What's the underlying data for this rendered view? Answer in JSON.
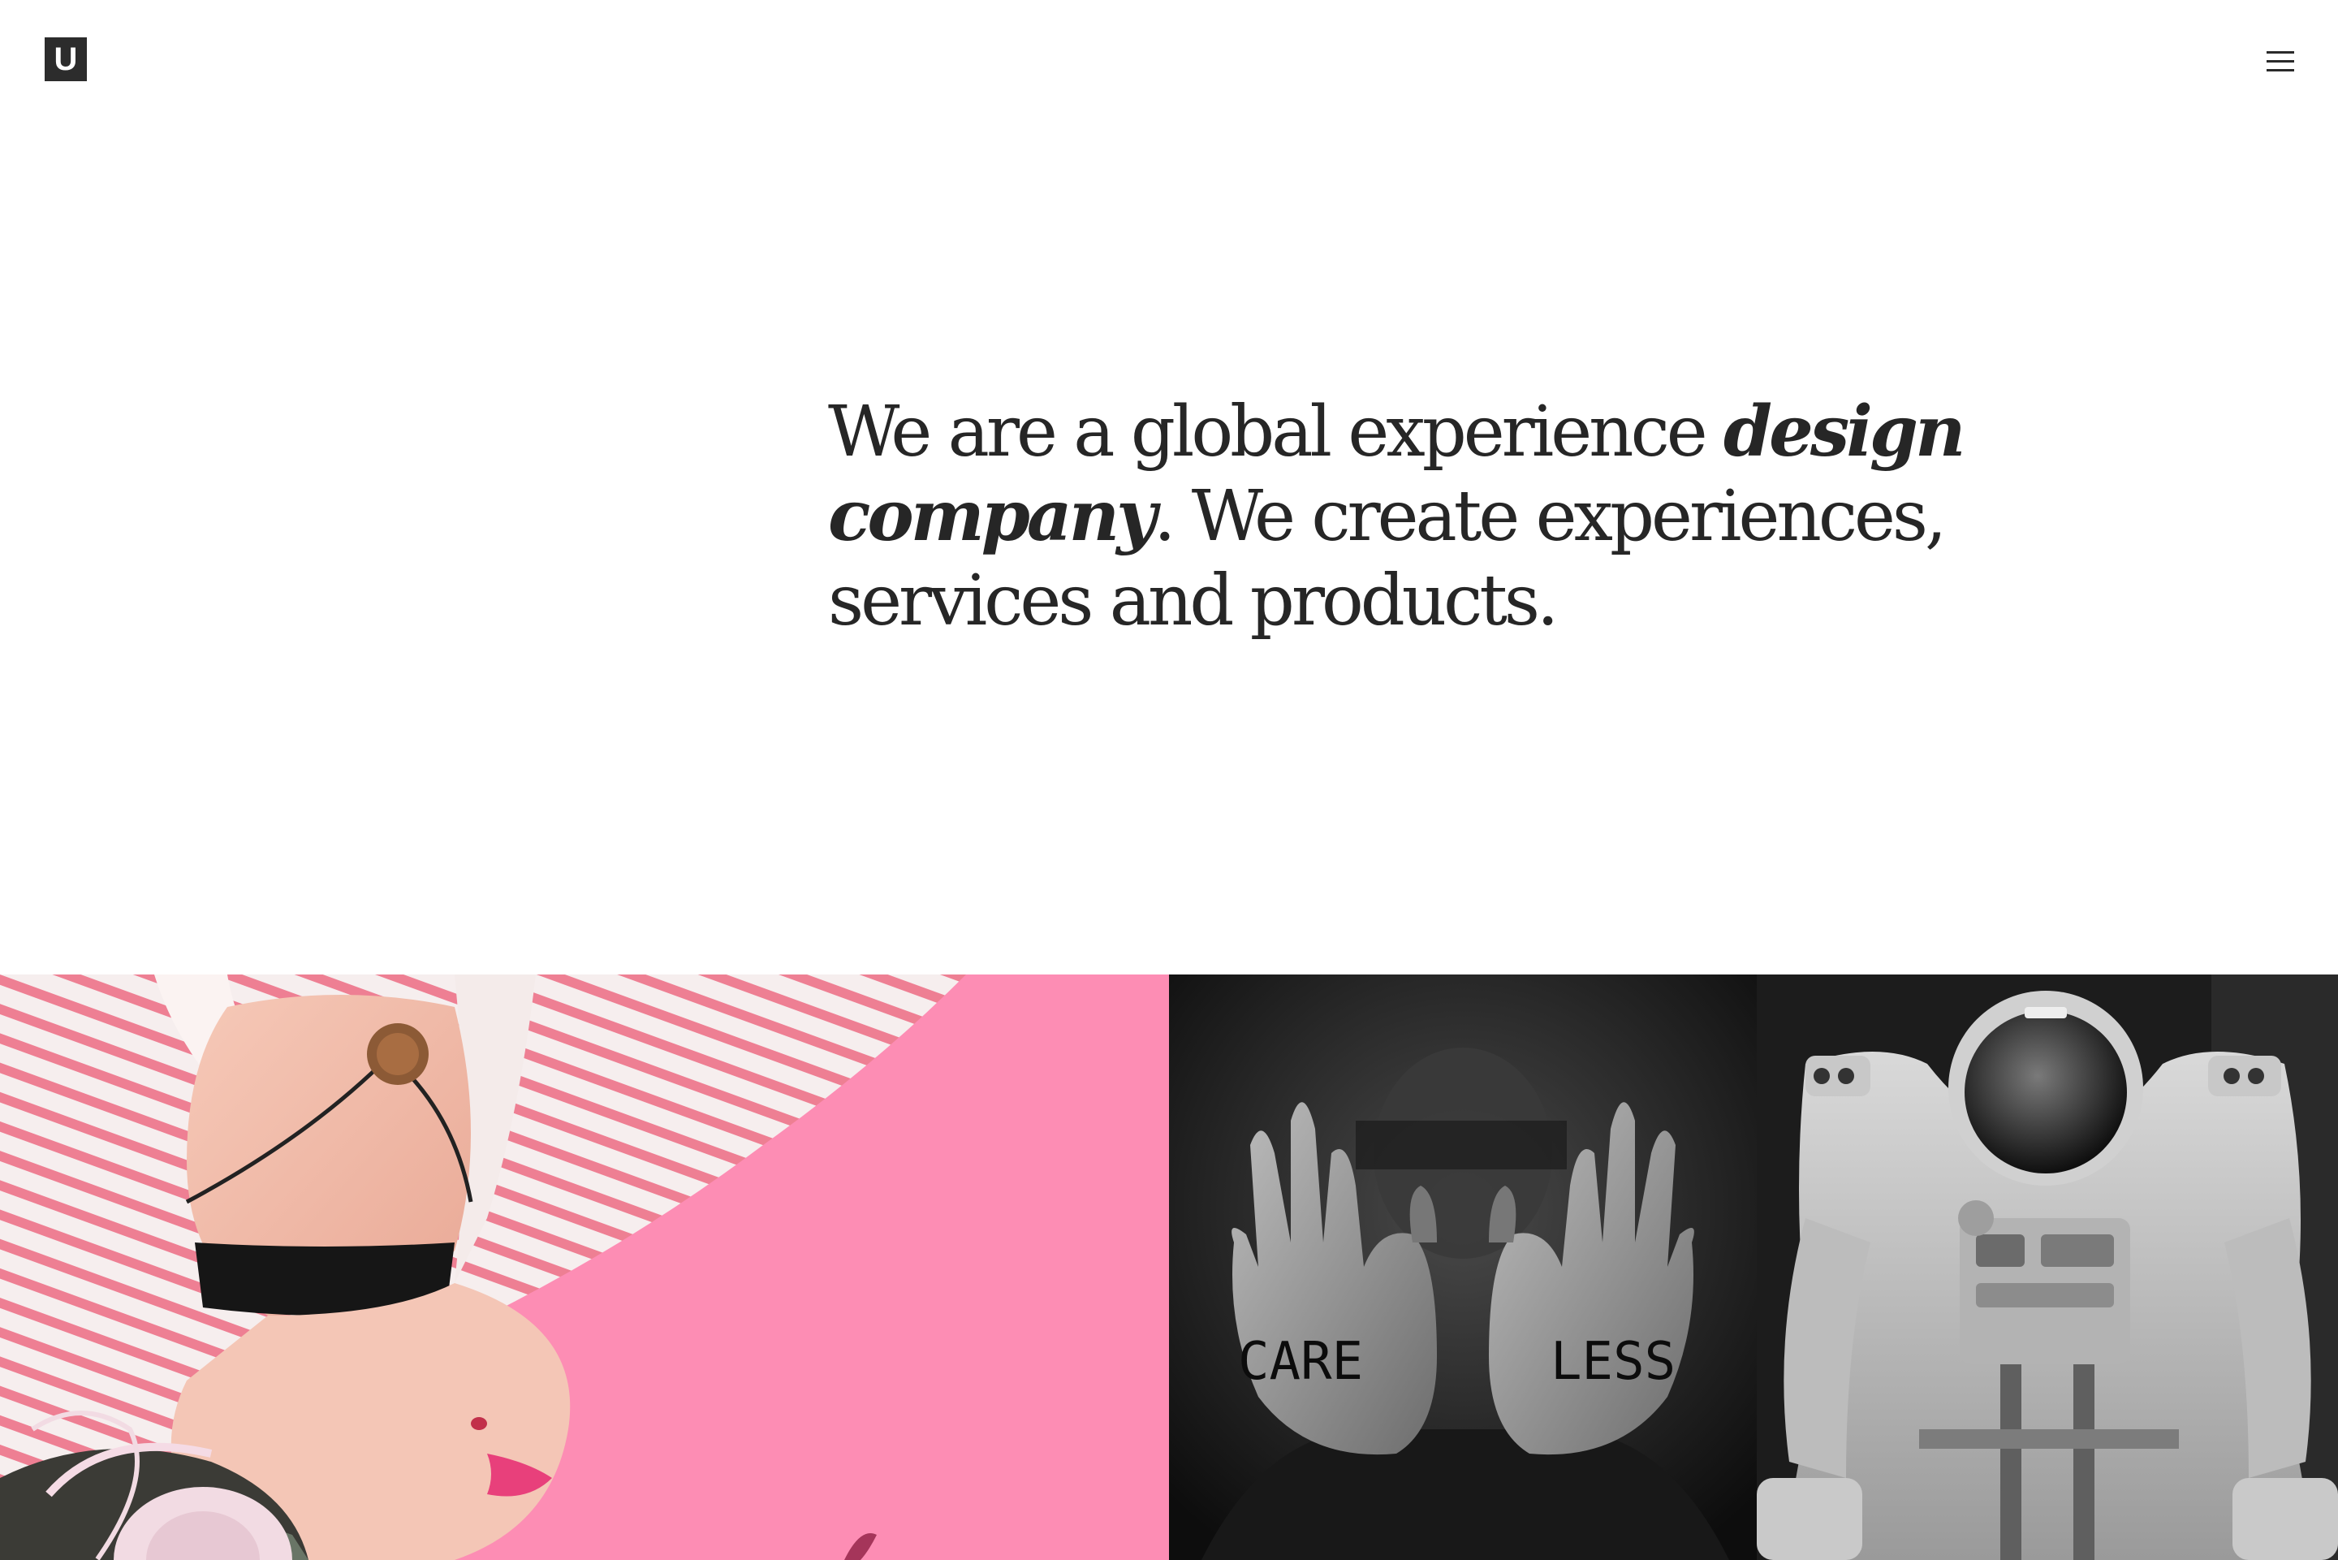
{
  "header": {
    "logo_text": "U",
    "menu_icon": "hamburger-menu-icon"
  },
  "hero": {
    "text_before": "We are a global experience ",
    "emphasis": "design company",
    "text_after": ". We create experiences, services and products."
  },
  "gallery": {
    "tiles": [
      {
        "name": "pink-fashion-photo",
        "palm_left": "",
        "palm_right": ""
      },
      {
        "name": "care-less-hands-photo",
        "palm_left": "CARE",
        "palm_right": "LESS"
      },
      {
        "name": "astronaut-suit-photo"
      }
    ]
  },
  "colors": {
    "text": "#262626",
    "logo_bg": "#2c2c2c",
    "pink": "#fd8db4"
  }
}
